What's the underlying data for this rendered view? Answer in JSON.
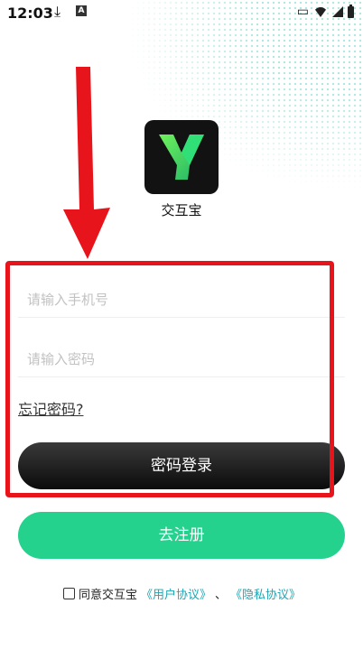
{
  "status_bar": {
    "time": "12:03",
    "download_icon": "download-icon",
    "notification_icon": "A"
  },
  "app": {
    "name": "交互宝",
    "logo_letter": "Y",
    "logo_color": "#7de84f"
  },
  "form": {
    "phone_placeholder": "请输入手机号",
    "password_placeholder": "请输入密码",
    "forgot_label": "忘记密码?",
    "login_label": "密码登录",
    "register_label": "去注册"
  },
  "agreement": {
    "prefix": "同意交互宝",
    "user_agreement": "《用户协议》",
    "separator": "、",
    "privacy_agreement": "《隐私协议》"
  },
  "colors": {
    "accent_green": "#25d28d",
    "annotation_red": "#e8141c",
    "link": "#1ca7b4"
  }
}
